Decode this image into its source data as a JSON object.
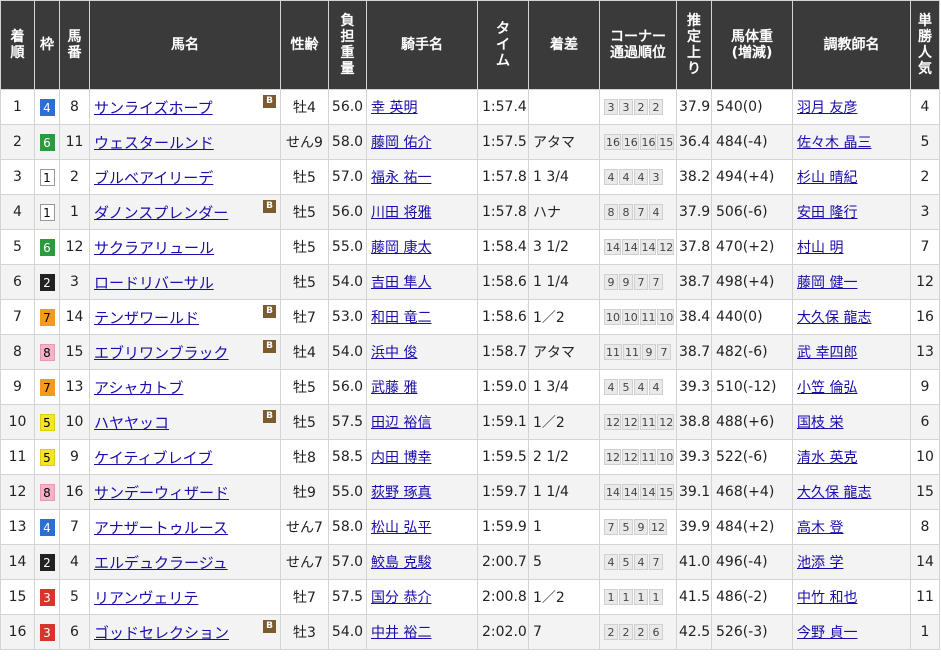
{
  "headers": [
    "着順",
    "枠",
    "馬番",
    "馬名",
    "性齢",
    "負担重量",
    "騎手名",
    "タイム",
    "着差",
    "コーナー通過順位",
    "推定上り",
    "馬体重(増減)",
    "調教師名",
    "単勝人気"
  ],
  "header_lines": {
    "rank": "着\n順",
    "frame": "枠",
    "num": "馬\n番",
    "horse": "馬名",
    "sexage": "性齢",
    "weight": "負\n担\n重\n量",
    "jockey": "騎手名",
    "time": "タ\nイ\nム",
    "margin": "着差",
    "corner": "コーナー\n通過順位",
    "last3f": "推\n定\n上\nり",
    "bodyweight": "馬体重\n(増減)",
    "trainer": "調教師名",
    "pop": "単\n勝\n人\n気"
  },
  "blinker_label": "B",
  "frame_colors": {
    "1": {
      "bg": "#ffffff",
      "fg": "#000000",
      "border": "#999999"
    },
    "2": {
      "bg": "#222222",
      "fg": "#ffffff",
      "border": "#222222"
    },
    "3": {
      "bg": "#d9332b",
      "fg": "#ffffff",
      "border": "#d9332b"
    },
    "4": {
      "bg": "#2a6fd6",
      "fg": "#ffffff",
      "border": "#2a6fd6"
    },
    "5": {
      "bg": "#f5e32a",
      "fg": "#000000",
      "border": "#e0cf10"
    },
    "6": {
      "bg": "#2c9a3f",
      "fg": "#ffffff",
      "border": "#2c9a3f"
    },
    "7": {
      "bg": "#f59a1f",
      "fg": "#000000",
      "border": "#f59a1f"
    },
    "8": {
      "bg": "#f3b2c6",
      "fg": "#000000",
      "border": "#e69ab2"
    }
  },
  "rows": [
    {
      "rank": "1",
      "frame": "4",
      "num": "8",
      "horse": "サンライズホープ",
      "blinker": true,
      "sexage": "牡4",
      "weight": "56.0",
      "jockey": "幸 英明",
      "time": "1:57.4",
      "margin": "",
      "corners": [
        "3",
        "3",
        "2",
        "2"
      ],
      "last3f": "37.9",
      "bodyweight": "540(0)",
      "trainer": "羽月 友彦",
      "pop": "4"
    },
    {
      "rank": "2",
      "frame": "6",
      "num": "11",
      "horse": "ウェスタールンド",
      "blinker": false,
      "sexage": "せん9",
      "weight": "58.0",
      "jockey": "藤岡 佑介",
      "time": "1:57.5",
      "margin": "アタマ",
      "corners": [
        "16",
        "16",
        "16",
        "15"
      ],
      "last3f": "36.4",
      "bodyweight": "484(-4)",
      "trainer": "佐々木 晶三",
      "pop": "5"
    },
    {
      "rank": "3",
      "frame": "1",
      "num": "2",
      "horse": "ブルベアイリーデ",
      "blinker": false,
      "sexage": "牡5",
      "weight": "57.0",
      "jockey": "福永 祐一",
      "time": "1:57.8",
      "margin": "1 3/4",
      "corners": [
        "4",
        "4",
        "4",
        "3"
      ],
      "last3f": "38.2",
      "bodyweight": "494(+4)",
      "trainer": "杉山 晴紀",
      "pop": "2"
    },
    {
      "rank": "4",
      "frame": "1",
      "num": "1",
      "horse": "ダノンスプレンダー",
      "blinker": true,
      "sexage": "牡5",
      "weight": "56.0",
      "jockey": "川田 将雅",
      "time": "1:57.8",
      "margin": "ハナ",
      "corners": [
        "8",
        "8",
        "7",
        "4"
      ],
      "last3f": "37.9",
      "bodyweight": "506(-6)",
      "trainer": "安田 隆行",
      "pop": "3"
    },
    {
      "rank": "5",
      "frame": "6",
      "num": "12",
      "horse": "サクラアリュール",
      "blinker": false,
      "sexage": "牡5",
      "weight": "55.0",
      "jockey": "藤岡 康太",
      "time": "1:58.4",
      "margin": "3 1/2",
      "corners": [
        "14",
        "14",
        "14",
        "12"
      ],
      "last3f": "37.8",
      "bodyweight": "470(+2)",
      "trainer": "村山 明",
      "pop": "7"
    },
    {
      "rank": "6",
      "frame": "2",
      "num": "3",
      "horse": "ロードリバーサル",
      "blinker": false,
      "sexage": "牡5",
      "weight": "54.0",
      "jockey": "吉田 隼人",
      "time": "1:58.6",
      "margin": "1 1/4",
      "corners": [
        "9",
        "9",
        "7",
        "7"
      ],
      "last3f": "38.7",
      "bodyweight": "498(+4)",
      "trainer": "藤岡 健一",
      "pop": "12"
    },
    {
      "rank": "7",
      "frame": "7",
      "num": "14",
      "horse": "テンザワールド",
      "blinker": true,
      "sexage": "牡7",
      "weight": "53.0",
      "jockey": "和田 竜二",
      "time": "1:58.6",
      "margin": "1／2",
      "corners": [
        "10",
        "10",
        "11",
        "10"
      ],
      "last3f": "38.4",
      "bodyweight": "440(0)",
      "trainer": "大久保 龍志",
      "pop": "16"
    },
    {
      "rank": "8",
      "frame": "8",
      "num": "15",
      "horse": "エブリワンブラック",
      "blinker": true,
      "sexage": "牡4",
      "weight": "54.0",
      "jockey": "浜中 俊",
      "time": "1:58.7",
      "margin": "アタマ",
      "corners": [
        "11",
        "11",
        "9",
        "7"
      ],
      "last3f": "38.7",
      "bodyweight": "482(-6)",
      "trainer": "武 幸四郎",
      "pop": "13"
    },
    {
      "rank": "9",
      "frame": "7",
      "num": "13",
      "horse": "アシャカトブ",
      "blinker": false,
      "sexage": "牡5",
      "weight": "56.0",
      "jockey": "武藤 雅",
      "time": "1:59.0",
      "margin": "1 3/4",
      "corners": [
        "4",
        "5",
        "4",
        "4"
      ],
      "last3f": "39.3",
      "bodyweight": "510(-12)",
      "trainer": "小笠 倫弘",
      "pop": "9"
    },
    {
      "rank": "10",
      "frame": "5",
      "num": "10",
      "horse": "ハヤヤッコ",
      "blinker": true,
      "sexage": "牡5",
      "weight": "57.5",
      "jockey": "田辺 裕信",
      "time": "1:59.1",
      "margin": "1／2",
      "corners": [
        "12",
        "12",
        "11",
        "12"
      ],
      "last3f": "38.8",
      "bodyweight": "488(+6)",
      "trainer": "国枝 栄",
      "pop": "6"
    },
    {
      "rank": "11",
      "frame": "5",
      "num": "9",
      "horse": "ケイティブレイブ",
      "blinker": false,
      "sexage": "牡8",
      "weight": "58.5",
      "jockey": "内田 博幸",
      "time": "1:59.5",
      "margin": "2 1/2",
      "corners": [
        "12",
        "12",
        "11",
        "10"
      ],
      "last3f": "39.3",
      "bodyweight": "522(-6)",
      "trainer": "清水 英克",
      "pop": "10"
    },
    {
      "rank": "12",
      "frame": "8",
      "num": "16",
      "horse": "サンデーウィザード",
      "blinker": false,
      "sexage": "牡9",
      "weight": "55.0",
      "jockey": "荻野 琢真",
      "time": "1:59.7",
      "margin": "1 1/4",
      "corners": [
        "14",
        "14",
        "14",
        "15"
      ],
      "last3f": "39.1",
      "bodyweight": "468(+4)",
      "trainer": "大久保 龍志",
      "pop": "15"
    },
    {
      "rank": "13",
      "frame": "4",
      "num": "7",
      "horse": "アナザートゥルース",
      "blinker": false,
      "sexage": "せん7",
      "weight": "58.0",
      "jockey": "松山 弘平",
      "time": "1:59.9",
      "margin": "1",
      "corners": [
        "7",
        "5",
        "9",
        "12"
      ],
      "last3f": "39.9",
      "bodyweight": "484(+2)",
      "trainer": "高木 登",
      "pop": "8"
    },
    {
      "rank": "14",
      "frame": "2",
      "num": "4",
      "horse": "エルデュクラージュ",
      "blinker": false,
      "sexage": "せん7",
      "weight": "57.0",
      "jockey": "鮫島 克駿",
      "time": "2:00.7",
      "margin": "5",
      "corners": [
        "4",
        "5",
        "4",
        "7"
      ],
      "last3f": "41.0",
      "bodyweight": "496(-4)",
      "trainer": "池添 学",
      "pop": "14"
    },
    {
      "rank": "15",
      "frame": "3",
      "num": "5",
      "horse": "リアンヴェリテ",
      "blinker": false,
      "sexage": "牡7",
      "weight": "57.5",
      "jockey": "国分 恭介",
      "time": "2:00.8",
      "margin": "1／2",
      "corners": [
        "1",
        "1",
        "1",
        "1"
      ],
      "last3f": "41.5",
      "bodyweight": "486(-2)",
      "trainer": "中竹 和也",
      "pop": "11"
    },
    {
      "rank": "16",
      "frame": "3",
      "num": "6",
      "horse": "ゴッドセレクション",
      "blinker": true,
      "sexage": "牡3",
      "weight": "54.0",
      "jockey": "中井 裕二",
      "time": "2:02.0",
      "margin": "7",
      "corners": [
        "2",
        "2",
        "2",
        "6"
      ],
      "last3f": "42.5",
      "bodyweight": "526(-3)",
      "trainer": "今野 貞一",
      "pop": "1"
    }
  ]
}
